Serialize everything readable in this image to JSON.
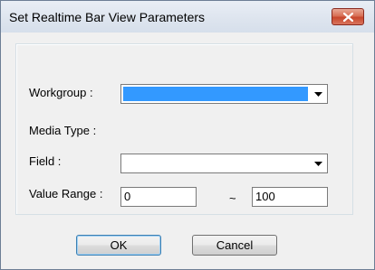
{
  "window": {
    "title": "Set Realtime Bar View Parameters"
  },
  "form": {
    "workgroup_label": "Workgroup :",
    "workgroup_value": "",
    "media_type_label": "Media Type :",
    "field_label": "Field :",
    "field_value": "",
    "value_range_label": "Value Range :",
    "range_min": "0",
    "range_separator": "~",
    "range_max": "100"
  },
  "buttons": {
    "ok_label": "OK",
    "cancel_label": "Cancel"
  },
  "icons": {
    "close": "close-icon",
    "dropdown": "chevron-down-icon"
  },
  "colors": {
    "selection": "#3399ff",
    "close_button": "#c7462b"
  }
}
